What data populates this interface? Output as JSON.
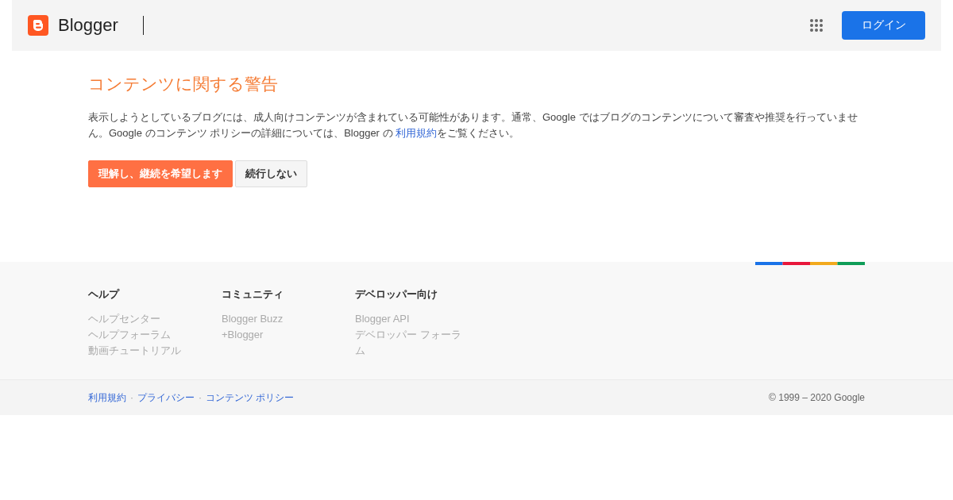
{
  "header": {
    "logo_text": "Blogger",
    "login_button": "ログイン"
  },
  "warning": {
    "title": "コンテンツに関する警告",
    "text_before": "表示しようとしているブログには、成人向けコンテンツが含まれている可能性があります。通常、Google ではブログのコンテンツについて審査や推奨を行っていません。Google のコンテンツ ポリシーの詳細については、Blogger の ",
    "link": "利用規約",
    "text_after": "をご覧ください。",
    "buttons": [
      {
        "label": "理解し、継続を希望します",
        "kind": "primary"
      },
      {
        "label": "続行しない",
        "kind": "secondary"
      }
    ]
  },
  "footer": {
    "columns": [
      {
        "heading": "ヘルプ",
        "links": [
          "ヘルプセンター",
          "ヘルプフォーラム",
          "動画チュートリアル"
        ]
      },
      {
        "heading": "コミュニティ",
        "links": [
          "Blogger Buzz",
          "+Blogger"
        ]
      },
      {
        "heading": "デベロッパー向け",
        "links": [
          "Blogger API",
          "デベロッパー フォーラム"
        ]
      }
    ],
    "bottom_links": [
      "利用規約",
      "プライバシー",
      "コンテンツ ポリシー"
    ],
    "separator": "·",
    "copyright": "© 1999 – 2020 Google"
  }
}
